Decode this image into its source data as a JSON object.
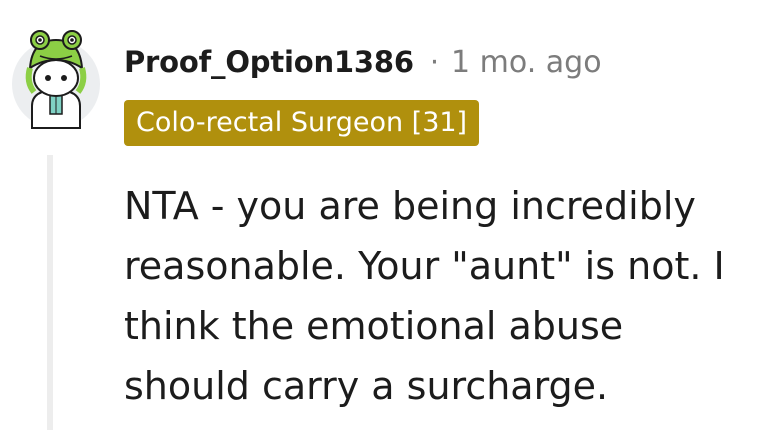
{
  "comment": {
    "author": "Proof_Option1386",
    "separator": "·",
    "timestamp": "1 mo. ago",
    "flair": {
      "text": "Colo-rectal Surgeon [31]",
      "background_color": "#b0900d",
      "text_color": "#ffffff"
    },
    "avatar": {
      "icon": "snoo-frog-hat-avatar-icon"
    },
    "body_lines": [
      "NTA - you are being incredibly",
      "reasonable. Your \"aunt\" is not. I",
      "think the emotional abuse",
      "should carry a surcharge."
    ]
  }
}
